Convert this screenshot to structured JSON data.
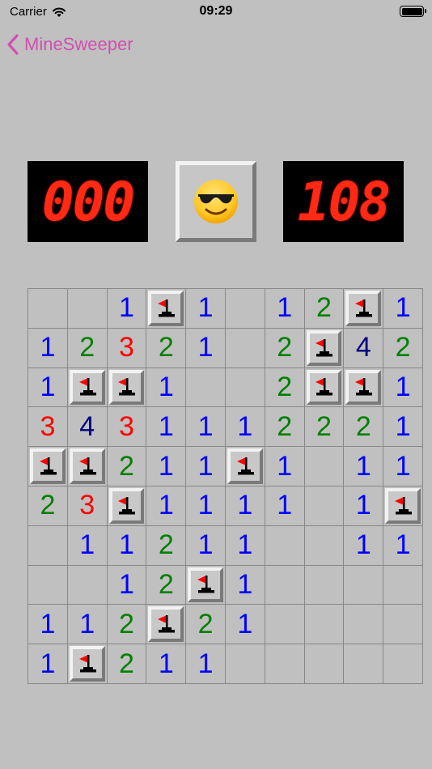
{
  "status_bar": {
    "carrier": "Carrier",
    "time": "09:29"
  },
  "nav": {
    "back_label": "MineSweeper"
  },
  "mine_counter": "000",
  "timer": "108",
  "face": {
    "icon": "sunglasses-face-icon",
    "glyph": "😎"
  },
  "colors": {
    "n1": "#0000ff",
    "n2": "#008000",
    "n3": "#ff0000",
    "n4": "#000080",
    "accent": "#d24fb0",
    "lcd": "#ff2a14"
  },
  "board": [
    [
      "",
      "",
      "1",
      "F",
      "1",
      "",
      "1",
      "2",
      "F",
      "1"
    ],
    [
      "1",
      "2",
      "3",
      "2",
      "1",
      "",
      "2",
      "F",
      "4",
      "2"
    ],
    [
      "1",
      "F",
      "F",
      "1",
      "",
      "",
      "2",
      "F",
      "F",
      "1"
    ],
    [
      "3",
      "4",
      "3",
      "1",
      "1",
      "1",
      "2",
      "2",
      "2",
      "1"
    ],
    [
      "F",
      "F",
      "2",
      "1",
      "1",
      "F",
      "1",
      "",
      "1",
      "1"
    ],
    [
      "2",
      "3",
      "F",
      "1",
      "1",
      "1",
      "1",
      "",
      "1",
      "F"
    ],
    [
      "",
      "1",
      "1",
      "2",
      "1",
      "1",
      "",
      "",
      "1",
      "1"
    ],
    [
      "",
      "",
      "1",
      "2",
      "F",
      "1",
      "",
      "",
      "",
      ""
    ],
    [
      "1",
      "1",
      "2",
      "F",
      "2",
      "1",
      "",
      "",
      "",
      ""
    ],
    [
      "1",
      "F",
      "2",
      "1",
      "1",
      "",
      "",
      "",
      "",
      ""
    ]
  ]
}
